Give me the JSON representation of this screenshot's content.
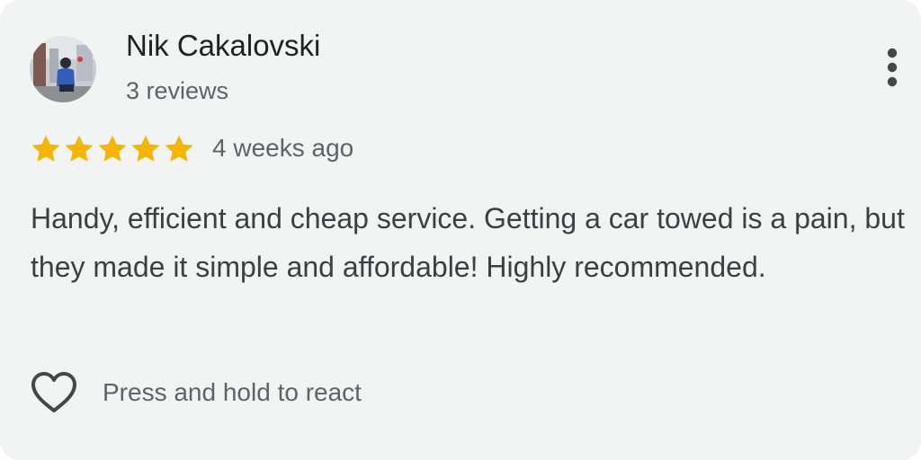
{
  "reviewer": {
    "name": "Nik Cakalovski",
    "review_count": "3 reviews",
    "avatar_icon": "user-photo-avatar"
  },
  "review": {
    "rating": 5,
    "rating_max": 5,
    "star_color": "#f4b400",
    "date": "4 weeks ago",
    "text": "Handy, efficient and cheap service. Getting a car towed is a pain, but they made it simple and affordable! Highly recommended."
  },
  "actions": {
    "more_icon": "more-vertical-icon",
    "react_icon": "heart-outline-icon",
    "react_label": "Press and hold to react"
  }
}
